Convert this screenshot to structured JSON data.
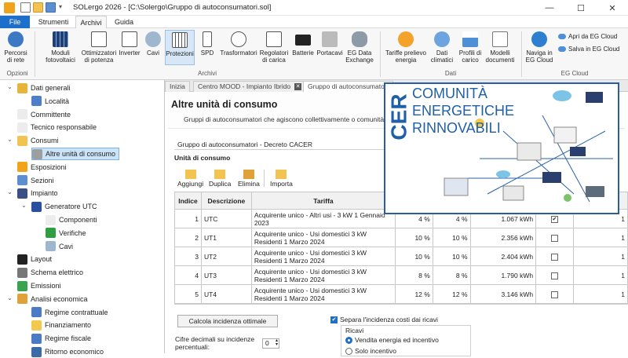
{
  "window": {
    "title": "SOLergo 2026 - [C:\\Solergo\\Gruppo di autoconsumatori.sol]",
    "minimize": "—",
    "maximize": "☐",
    "close": "✕"
  },
  "tabs": [
    "File",
    "Strumenti",
    "Archivi",
    "Guida"
  ],
  "ribbon": {
    "buttons": [
      "Percorsi di rete",
      "Moduli fotovoltaici",
      "Ottimizzatori di potenza",
      "Inverter",
      "Cavi",
      "Protezioni",
      "SPD",
      "Trasformatori",
      "Regolatori di carica",
      "Batterie",
      "Portacavi",
      "EG Data Exchange",
      "Tariffe prelievo energia",
      "Dati climatici",
      "Profili di carico",
      "Modelli documenti",
      "Naviga in EG Cloud"
    ],
    "small": [
      "Apri da EG Cloud",
      "Salva in EG Cloud"
    ],
    "groups": [
      "Opzioni",
      "Archivi",
      "Dati",
      "EG Cloud"
    ]
  },
  "tree": [
    "Dati generali",
    "Località",
    "Committente",
    "Tecnico responsabile",
    "Consumi",
    "Altre unità di consumo",
    "Esposizioni",
    "Sezioni",
    "Impianto",
    "Generatore UTC",
    "Componenti",
    "Verifiche",
    "Cavi",
    "Layout",
    "Schema elettrico",
    "Emissioni",
    "Analisi economica",
    "Regime contrattuale",
    "Finanziamento",
    "Regime fiscale",
    "Ritorno economico"
  ],
  "doc_tabs": [
    "Inizia",
    "Centro MOOD - Impianto Ibrido",
    "Gruppo di autoconsumatori"
  ],
  "page": {
    "title": "Altre unità di consumo",
    "subtitle": "Gruppi di autoconsumatori che agiscono collettivamente o comunità e",
    "group": "Gruppo di autoconsumatori - Decreto CACER",
    "units_label": "Unità di consumo",
    "toolbar": [
      "Aggiungi",
      "Duplica",
      "Elimina",
      "Importa"
    ],
    "columns": [
      "Indice",
      "Descrizione",
      "Tariffa"
    ],
    "rows": [
      {
        "i": "1",
        "d": "UTC",
        "t": "Acquirente unico - Altri usi - 3 kW 1 Gennaio 2023",
        "p1": "4 %",
        "p2": "4 %",
        "kwh": "1.067 kWh",
        "chk": "✔",
        "q": "1"
      },
      {
        "i": "2",
        "d": "UT1",
        "t": "Acquirente unico - Usi domestici 3 kW Residenti 1 Marzo 2024",
        "p1": "10 %",
        "p2": "10 %",
        "kwh": "2.356 kWh",
        "chk": "",
        "q": "1"
      },
      {
        "i": "3",
        "d": "UT2",
        "t": "Acquirente unico - Usi domestici 3 kW Residenti 1 Marzo 2024",
        "p1": "10 %",
        "p2": "10 %",
        "kwh": "2.404 kWh",
        "chk": "",
        "q": "1"
      },
      {
        "i": "4",
        "d": "UT3",
        "t": "Acquirente unico - Usi domestici 3 kW Residenti 1 Marzo 2024",
        "p1": "8 %",
        "p2": "8 %",
        "kwh": "1.790 kWh",
        "chk": "",
        "q": "1"
      },
      {
        "i": "5",
        "d": "UT4",
        "t": "Acquirente unico - Usi domestici 3 kW Residenti 1 Marzo 2024",
        "p1": "12 %",
        "p2": "12 %",
        "kwh": "3.146 kWh",
        "chk": "",
        "q": "1"
      }
    ],
    "calc_button": "Calcola incidenza ottimale",
    "decimals_label": "Cifre decimali su incidenze percentuali:",
    "decimals_value": "0",
    "separa": "Separa l'incidenza costi dai ricavi",
    "ricavi": "Ricavi",
    "radio1": "Vendita energia ed incentivo",
    "radio2": "Solo incentivo"
  },
  "overlay": {
    "cer": "CER",
    "line1": "COMUNITÀ",
    "line2": "ENERGETICHE",
    "line3": "RINNOVABILI"
  },
  "colors": {
    "file_tab": "#1e6fc9",
    "accent": "#2a5ea3",
    "selection": "#cce3f7"
  }
}
